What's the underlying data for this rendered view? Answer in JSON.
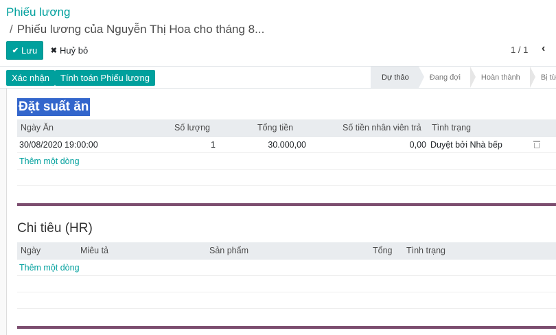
{
  "breadcrumb": {
    "root": "Phiếu lương",
    "separator": "/",
    "current": "Phiếu lương của Nguyễn Thị Hoa cho tháng 8..."
  },
  "toolbar": {
    "save_label": "Lưu",
    "discard_label": "Huỷ bỏ",
    "save_icon": "check-icon",
    "discard_icon": "times-icon"
  },
  "pager": {
    "value": "1 / 1",
    "prev_icon": "chevron-left-icon"
  },
  "header_actions": {
    "confirm_label": "Xác nhận",
    "compute_label": "Tính toán Phiếu lương"
  },
  "statusbar": {
    "stages": [
      "Dự thảo",
      "Đang đợi",
      "Hoàn thành",
      "Bị từ ch"
    ],
    "active_index": 0
  },
  "meals": {
    "title": "Đặt suất ăn",
    "columns": [
      "Ngày Ăn",
      "Số lượng",
      "Tổng tiền",
      "Số tiền nhân viên trả",
      "Tình trạng"
    ],
    "rows": [
      {
        "date": "30/08/2020 19:00:00",
        "qty": "1",
        "total": "30.000,00",
        "employee_paid": "0,00",
        "status": "Duyệt bởi Nhà bếp"
      }
    ],
    "add_line": "Thêm một dòng"
  },
  "hr_expenses": {
    "title": "Chi tiêu (HR)",
    "columns": [
      "Ngày",
      "Miêu tả",
      "Sản phẩm",
      "Tổng",
      "Tình trạng"
    ],
    "add_line": "Thêm một dòng"
  },
  "colors": {
    "accent": "#00a09d",
    "divider": "#7c4d6f",
    "selection": "#3366cc"
  }
}
